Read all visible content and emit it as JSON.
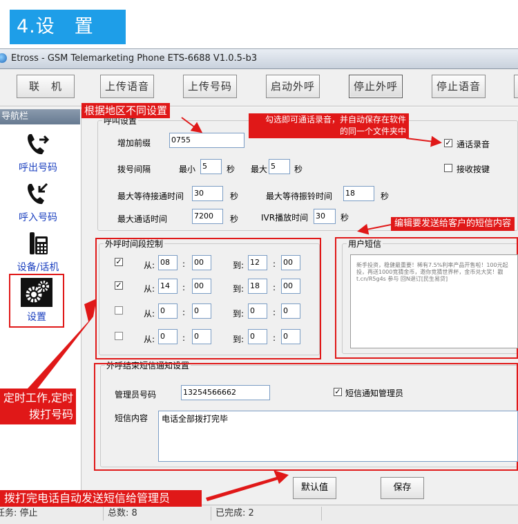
{
  "section_title": "4.设　置",
  "window_title": "Etross - GSM Telemarketing Phone ETS-6688 V1.0.5-b3",
  "toolbar": {
    "contact": "联　机",
    "upload_voice": "上传语音",
    "upload_numbers": "上传号码",
    "start_dial": "启动外呼",
    "stop_dial": "停止外呼",
    "stop_voice": "停止语音"
  },
  "sidebar": {
    "header": "导航栏",
    "items": [
      {
        "label": "呼出号码",
        "icon": "outgoing-call-icon"
      },
      {
        "label": "呼入号码",
        "icon": "incoming-call-icon"
      },
      {
        "label": "设备/话机",
        "icon": "desk-phone-icon"
      },
      {
        "label": "设置",
        "icon": "gear-icon"
      }
    ]
  },
  "call_settings": {
    "legend": "呼叫设置",
    "prefix_label": "增加前缀",
    "prefix_value": "0755",
    "interval_label": "拨号间隔",
    "min_label": "最小",
    "min_value": "5",
    "max_label": "最大",
    "max_value": "5",
    "sec": "秒",
    "max_wait_connect_label": "最大等待接通时间",
    "max_wait_connect_value": "30",
    "max_wait_ring_label": "最大等待振铃时间",
    "max_wait_ring_value": "18",
    "max_call_label": "最大通话时间",
    "max_call_value": "7200",
    "ivr_label": "IVR播放时间",
    "ivr_value": "30",
    "record_label": "通话录音",
    "record_checked": true,
    "key_label": "接收按键",
    "key_checked": false
  },
  "time_control": {
    "legend": "外呼时间段控制",
    "from": "从:",
    "to": "到:",
    "colon": ":",
    "rows": [
      {
        "checked": true,
        "fh": "08",
        "fm": "00",
        "th": "12",
        "tm": "00"
      },
      {
        "checked": true,
        "fh": "14",
        "fm": "00",
        "th": "18",
        "tm": "00"
      },
      {
        "checked": false,
        "fh": "0",
        "fm": "0",
        "th": "0",
        "tm": "0"
      },
      {
        "checked": false,
        "fh": "0",
        "fm": "0",
        "th": "0",
        "tm": "0"
      }
    ]
  },
  "user_sms": {
    "legend": "用户短信",
    "text": "新手投资，稳健最重要！稀有7.5%利率产品开售啦！100元起投，再送1000竞猜金币，邀你竞猜世界杯，金币兑大奖！戳 t.cn/R5g4s 参与 回N退订[民生易贷]"
  },
  "end_notice": {
    "legend": "外呼结束短信通知设置",
    "admin_label": "管理员号码",
    "admin_value": "13254566662",
    "notify_label": "短信通知管理员",
    "notify_checked": true,
    "content_label": "短信内容",
    "content_value": "电话全部拨打完毕"
  },
  "buttons": {
    "default": "默认值",
    "save": "保存"
  },
  "status": {
    "task": "任务: 停止",
    "total": "总数: 8",
    "done": "已完成: 2"
  },
  "callouts": {
    "region": "根据地区不同设置",
    "record": "勾选即可通话录音，并自动保存在软件的同一个文件夹中",
    "record_line1": "勾选即可通话录音，并自动保存在软件",
    "record_line2": "的同一个文件夹中",
    "sms": "编辑要发送给客户的短信内容",
    "timed_line1": "定时工作,定时",
    "timed_line2": "拨打号码",
    "admin_sms": "拨打完电话自动发送短信给管理员"
  },
  "colors": {
    "accent_blue": "#1e9ee8",
    "callout_red": "#e01818",
    "nav_blue": "#1a3fbf"
  }
}
